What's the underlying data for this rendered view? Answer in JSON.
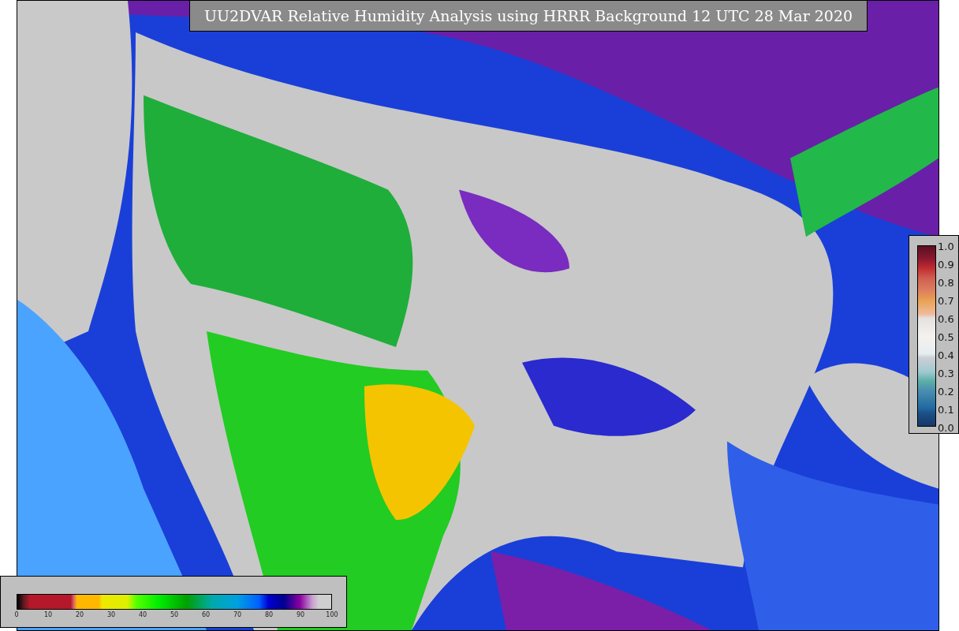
{
  "title": "UU2DVAR Relative Humidity Analysis using HRRR Background 12 UTC 28 Mar 2020",
  "colorbar_bottom": {
    "ticks": [
      "0",
      "10",
      "20",
      "30",
      "40",
      "50",
      "60",
      "70",
      "80",
      "90",
      "100"
    ]
  },
  "colorbar_right": {
    "ticks": [
      "1.0",
      "0.9",
      "0.8",
      "0.7",
      "0.6",
      "0.5",
      "0.4",
      "0.3",
      "0.2",
      "0.1",
      "0.0"
    ]
  }
}
